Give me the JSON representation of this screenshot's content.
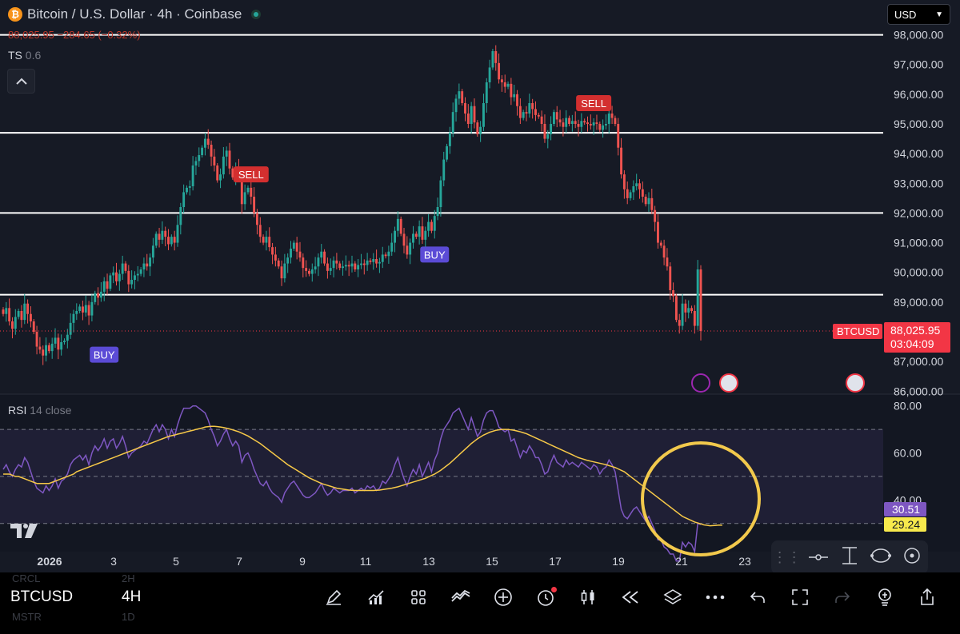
{
  "header": {
    "title": "Bitcoin / U.S. Dollar · 4h · Coinbase",
    "logo_glyph": "₿",
    "price_change": "88,025.95 −284.65 (−0.32%)",
    "indicator_ts_name": "TS",
    "indicator_ts_value": "0.6",
    "collapse_icon": "chevron-up-icon"
  },
  "currency_select": {
    "value": "USD"
  },
  "rsi_panel": {
    "name": "RSI",
    "params": "14 close",
    "value_rsi": "30.51",
    "value_ma": "29.24",
    "rsi_color": "#7e57c2",
    "ma_color": "#f7c948"
  },
  "last_price": {
    "symbol": "BTCUSD",
    "price": "88,025.95",
    "countdown": "03:04:09",
    "color": "#f23645"
  },
  "toolbar_bottom": {
    "symbol": "BTCUSD",
    "timeframe": "4H",
    "ghost_symbols": [
      "CRCL",
      "MSTR"
    ],
    "ghost_timeframes": [
      "2H",
      "1D"
    ],
    "icons": [
      "pencil-icon",
      "indicators-icon",
      "grid-icon",
      "compare-icon",
      "add-icon",
      "alert-icon",
      "candles-icon",
      "replay-icon",
      "layers-icon",
      "more-icon",
      "undo-icon",
      "fullscreen-icon",
      "redo-icon",
      "idea-icon",
      "share-icon"
    ]
  },
  "chart_data": {
    "type": "candlestick",
    "price_axis": {
      "ticks": [
        "98,000.00",
        "97,000.00",
        "96,000.00",
        "95,000.00",
        "94,000.00",
        "93,000.00",
        "92,000.00",
        "91,000.00",
        "90,000.00",
        "89,000.00",
        "87,000.00",
        "86,000.00"
      ],
      "ylim": [
        85900,
        98150
      ]
    },
    "rsi_axis": {
      "ticks": [
        "80.00",
        "60.00",
        "40.00"
      ],
      "ylim": [
        18,
        85
      ],
      "bands": [
        70,
        50,
        30
      ]
    },
    "x_axis": {
      "ticks": [
        "2026",
        "3",
        "5",
        "7",
        "9",
        "11",
        "13",
        "15",
        "17",
        "19",
        "21",
        "23"
      ]
    },
    "horizontal_lines": [
      98000,
      94700,
      92000,
      89250
    ],
    "signals": [
      {
        "label": "BUY",
        "bar": 33,
        "price": 87230,
        "color": "#5b4bd6"
      },
      {
        "label": "SELL",
        "bar": 81,
        "price": 93300,
        "color": "#d32f2f"
      },
      {
        "label": "BUY",
        "bar": 141,
        "price": 90600,
        "color": "#5b4bd6"
      },
      {
        "label": "SELL",
        "bar": 193,
        "price": 95700,
        "color": "#d32f2f"
      }
    ],
    "series_close": [
      88600,
      88800,
      88350,
      88100,
      88500,
      88700,
      88400,
      88950,
      88600,
      88350,
      88000,
      87500,
      87400,
      87200,
      87550,
      87350,
      87600,
      87800,
      87400,
      87650,
      87700,
      87900,
      88300,
      88600,
      88700,
      88850,
      88650,
      88900,
      88550,
      89000,
      89300,
      89150,
      89350,
      89700,
      89450,
      89900,
      90000,
      89700,
      89950,
      90300,
      90050,
      89600,
      89750,
      89900,
      89950,
      90100,
      90300,
      90200,
      90500,
      90900,
      91300,
      91100,
      91400,
      91200,
      90950,
      91200,
      91000,
      91600,
      92200,
      92700,
      92850,
      92900,
      93600,
      93750,
      93950,
      94200,
      94500,
      94300,
      93900,
      93600,
      93100,
      93300,
      93900,
      94100,
      93500,
      93200,
      93500,
      93300,
      92300,
      92700,
      92850,
      92550,
      92000,
      91600,
      91200,
      91000,
      91200,
      90850,
      90600,
      90400,
      90200,
      89800,
      90300,
      90500,
      90800,
      91000,
      90700,
      90500,
      90150,
      90050,
      89950,
      90100,
      90200,
      90500,
      90700,
      90300,
      90050,
      90150,
      90400,
      90300,
      90150,
      90200,
      90250,
      90200,
      90300,
      90100,
      90250,
      90300,
      90250,
      90400,
      90350,
      90450,
      90300,
      90350,
      90600,
      90550,
      90700,
      91000,
      91400,
      91800,
      91300,
      90900,
      90600,
      91000,
      91300,
      91200,
      91550,
      91100,
      91400,
      91700,
      91400,
      91900,
      92200,
      93100,
      93800,
      94250,
      94700,
      95400,
      95850,
      96100,
      95700,
      95350,
      95000,
      95600,
      95050,
      94650,
      94900,
      95700,
      96400,
      96900,
      97450,
      97050,
      96500,
      96400,
      96250,
      96350,
      95900,
      96000,
      95600,
      95200,
      95400,
      95350,
      95700,
      95500,
      95300,
      95250,
      95000,
      94500,
      94650,
      95000,
      95400,
      95150,
      95050,
      94900,
      95200,
      95000,
      95100,
      95000,
      94900,
      95100,
      95050,
      95000,
      94950,
      95050,
      95000,
      94800,
      94950,
      95000,
      95350,
      95200,
      95000,
      94200,
      93300,
      92800,
      92500,
      92700,
      92900,
      93000,
      92800,
      92550,
      92300,
      92500,
      92100,
      91700,
      91000,
      90900,
      90500,
      90200,
      89400,
      89200,
      88400,
      88200,
      88950,
      88650,
      88800,
      88700,
      88200,
      90100,
      88025.95
    ],
    "rsi_values": [
      53,
      55,
      52,
      50,
      53,
      55,
      54,
      58,
      56,
      52,
      48,
      45,
      44,
      43,
      46,
      44,
      46,
      49,
      45,
      48,
      49,
      51,
      55,
      57,
      58,
      59,
      57,
      59,
      55,
      60,
      63,
      61,
      63,
      66,
      62,
      65,
      66,
      62,
      64,
      67,
      63,
      58,
      60,
      61,
      62,
      63,
      65,
      64,
      67,
      70,
      72,
      69,
      72,
      70,
      66,
      70,
      67,
      72,
      76,
      79,
      79,
      79,
      80,
      80,
      79,
      78,
      77,
      74,
      70,
      67,
      63,
      65,
      68,
      70,
      66,
      63,
      65,
      63,
      56,
      59,
      60,
      57,
      53,
      50,
      47,
      46,
      48,
      45,
      43,
      42,
      41,
      39,
      43,
      45,
      47,
      48,
      46,
      44,
      42,
      41,
      41,
      42,
      43,
      45,
      47,
      44,
      42,
      43,
      45,
      44,
      43,
      44,
      44,
      44,
      45,
      43,
      44,
      45,
      44,
      46,
      45,
      46,
      44,
      45,
      48,
      47,
      49,
      51,
      55,
      58,
      53,
      49,
      46,
      50,
      53,
      51,
      55,
      50,
      53,
      56,
      52,
      57,
      60,
      66,
      70,
      72,
      74,
      77,
      78,
      79,
      76,
      73,
      70,
      75,
      71,
      67,
      69,
      74,
      77,
      78,
      78,
      75,
      71,
      70,
      69,
      70,
      65,
      66,
      62,
      58,
      61,
      60,
      63,
      61,
      58,
      58,
      55,
      51,
      52,
      56,
      59,
      56,
      55,
      54,
      57,
      55,
      56,
      55,
      54,
      56,
      55,
      54,
      53,
      55,
      54,
      51,
      53,
      54,
      57,
      55,
      52,
      44,
      36,
      33,
      32,
      34,
      36,
      37,
      35,
      33,
      31,
      33,
      30,
      27,
      23,
      23,
      20,
      19,
      17,
      17,
      14,
      14,
      22,
      20,
      22,
      21,
      18,
      30,
      29.5
    ],
    "rsi_ma_values": [
      51,
      51,
      51,
      50.5,
      50,
      50,
      49.5,
      49,
      48.5,
      48,
      47.5,
      47,
      47,
      47,
      47,
      47,
      47.5,
      48,
      48.5,
      49,
      49.5,
      50,
      50.5,
      51,
      52,
      52.5,
      53,
      53.5,
      54,
      54.5,
      55,
      55.5,
      56,
      56.5,
      57,
      57.5,
      58,
      58.5,
      59,
      59.5,
      60,
      60.5,
      61,
      61.5,
      62,
      62.5,
      63,
      63.5,
      64,
      64.5,
      65,
      65.5,
      66,
      66.5,
      67,
      67.3,
      67.6,
      68,
      68.3,
      68.6,
      69,
      69.3,
      69.6,
      70,
      70.3,
      70.6,
      71,
      71.2,
      71.3,
      71.3,
      71.2,
      71,
      70.8,
      70.5,
      70.2,
      69.8,
      69.4,
      69,
      68.4,
      67.8,
      67.2,
      66.4,
      65.6,
      64.8,
      64,
      63,
      62,
      61,
      60,
      59,
      58,
      57,
      56,
      55,
      54.2,
      53.4,
      52.6,
      51.8,
      51,
      50.2,
      49.4,
      48.8,
      48.2,
      47.6,
      47,
      46.6,
      46.2,
      45.8,
      45.4,
      45,
      44.8,
      44.6,
      44.4,
      44.2,
      44.1,
      44,
      44,
      44,
      44,
      44,
      44,
      44,
      44.1,
      44.2,
      44.4,
      44.6,
      44.8,
      45,
      45.3,
      45.6,
      46,
      46.4,
      46.8,
      47.2,
      47.6,
      48,
      48.4,
      48.8,
      49.2,
      49.8,
      50.4,
      51,
      51.8,
      52.6,
      53.6,
      54.6,
      55.6,
      56.8,
      58,
      59.2,
      60.4,
      61.6,
      62.8,
      64,
      65,
      66,
      66.8,
      67.6,
      68.2,
      68.8,
      69.2,
      69.6,
      69.8,
      70,
      70,
      70,
      69.8,
      69.6,
      69.3,
      69,
      68.6,
      68.2,
      67.6,
      67,
      66.4,
      65.8,
      65.2,
      64.6,
      64,
      63.4,
      62.8,
      62.2,
      61.6,
      61,
      60.4,
      59.8,
      59.2,
      58.6,
      58,
      57.6,
      57.2,
      56.8,
      56.5,
      56.2,
      55.9,
      55.6,
      55.3,
      55,
      54.6,
      54.2,
      53.8,
      53.2,
      52.6,
      52,
      51,
      50,
      49,
      48,
      47,
      46,
      45,
      44,
      43,
      42,
      41,
      40,
      39,
      38,
      37,
      36,
      35,
      34,
      33,
      32.4,
      31.8,
      31.2,
      30.6,
      30.2,
      29.8,
      29.4,
      29.2,
      29,
      29.1,
      29.2,
      29.3,
      29.24
    ]
  }
}
